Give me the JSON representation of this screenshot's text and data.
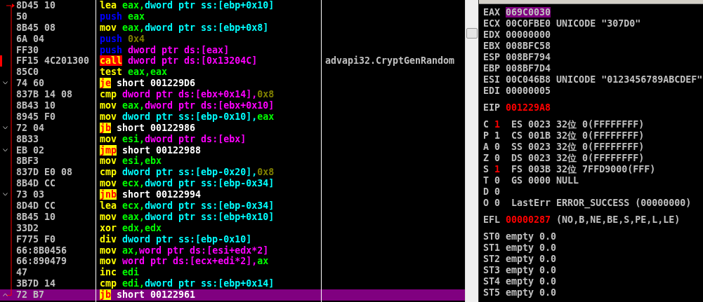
{
  "disassembly": {
    "rows": [
      {
        "hex": "8D45 10",
        "tokens": [
          {
            "text": "lea",
            "kind": "mnemonic"
          },
          {
            "text": " eax,",
            "kind": "register"
          },
          {
            "text": "dword ptr ss:[ebp+0x10]",
            "kind": "stack_mem"
          }
        ],
        "selected": false,
        "breakpoint": false
      },
      {
        "hex": "50",
        "tokens": [
          {
            "text": "push",
            "kind": "push"
          },
          {
            "text": " eax",
            "kind": "register"
          }
        ],
        "selected": false,
        "breakpoint": false
      },
      {
        "hex": "8B45 08",
        "tokens": [
          {
            "text": "mov",
            "kind": "mnemonic"
          },
          {
            "text": " eax,",
            "kind": "register"
          },
          {
            "text": "dword ptr ss:[ebp+0x8]",
            "kind": "stack_mem"
          }
        ],
        "selected": false,
        "breakpoint": false
      },
      {
        "hex": "6A 04",
        "tokens": [
          {
            "text": "push",
            "kind": "push"
          },
          {
            "text": " 0x4",
            "kind": "immediate"
          }
        ],
        "selected": false,
        "breakpoint": false
      },
      {
        "hex": "FF30",
        "tokens": [
          {
            "text": "push",
            "kind": "push"
          },
          {
            "text": " dword ptr ds:[eax]",
            "kind": "data_mem"
          }
        ],
        "selected": false,
        "breakpoint": false
      },
      {
        "hex": "FF15 4C201300",
        "tokens": [
          {
            "text": "call",
            "kind": "call"
          },
          {
            "text": " dword ptr ds:[0x13204C]",
            "kind": "data_mem"
          }
        ],
        "comment": "advapi32.CryptGenRandom",
        "selected": false,
        "breakpoint": true
      },
      {
        "hex": "85C0",
        "tokens": [
          {
            "text": "test",
            "kind": "mnemonic"
          },
          {
            "text": " eax,eax",
            "kind": "register"
          }
        ],
        "selected": false,
        "breakpoint": false
      },
      {
        "hex": "74 60",
        "jump": true,
        "backward": false,
        "tokens": [
          {
            "text": "je",
            "kind": "jump"
          },
          {
            "text": " short 001229D6",
            "kind": "target"
          }
        ],
        "selected": false,
        "breakpoint": false
      },
      {
        "hex": "837B 14 08",
        "tokens": [
          {
            "text": "cmp",
            "kind": "mnemonic"
          },
          {
            "text": " dword ptr ds:[ebx+0x14],",
            "kind": "data_mem"
          },
          {
            "text": "0x8",
            "kind": "immediate"
          }
        ],
        "selected": false,
        "breakpoint": false
      },
      {
        "hex": "8B43 10",
        "tokens": [
          {
            "text": "mov",
            "kind": "mnemonic"
          },
          {
            "text": " eax,",
            "kind": "register"
          },
          {
            "text": "dword ptr ds:[ebx+0x10]",
            "kind": "data_mem"
          }
        ],
        "selected": false,
        "breakpoint": false
      },
      {
        "hex": "8945 F0",
        "tokens": [
          {
            "text": "mov",
            "kind": "mnemonic"
          },
          {
            "text": " dword ptr ss:[ebp-0x10],",
            "kind": "stack_mem"
          },
          {
            "text": "eax",
            "kind": "register"
          }
        ],
        "selected": false,
        "breakpoint": false
      },
      {
        "hex": "72 04",
        "jump": true,
        "backward": false,
        "tokens": [
          {
            "text": "jb",
            "kind": "jump"
          },
          {
            "text": " short 00122986",
            "kind": "target"
          }
        ],
        "selected": false,
        "breakpoint": false
      },
      {
        "hex": "8B33",
        "tokens": [
          {
            "text": "mov",
            "kind": "mnemonic"
          },
          {
            "text": " esi,",
            "kind": "register"
          },
          {
            "text": "dword ptr ds:[ebx]",
            "kind": "data_mem"
          }
        ],
        "selected": false,
        "breakpoint": false
      },
      {
        "hex": "EB 02",
        "jump": true,
        "backward": false,
        "tokens": [
          {
            "text": "jmp",
            "kind": "jump"
          },
          {
            "text": " short 00122988",
            "kind": "target"
          }
        ],
        "selected": false,
        "breakpoint": false
      },
      {
        "hex": "8BF3",
        "tokens": [
          {
            "text": "mov",
            "kind": "mnemonic"
          },
          {
            "text": " esi,ebx",
            "kind": "register"
          }
        ],
        "selected": false,
        "breakpoint": false
      },
      {
        "hex": "837D E0 08",
        "tokens": [
          {
            "text": "cmp",
            "kind": "mnemonic"
          },
          {
            "text": " dword ptr ss:[ebp-0x20],",
            "kind": "stack_mem"
          },
          {
            "text": "0x8",
            "kind": "immediate"
          }
        ],
        "selected": false,
        "breakpoint": false
      },
      {
        "hex": "8B4D CC",
        "tokens": [
          {
            "text": "mov",
            "kind": "mnemonic"
          },
          {
            "text": " ecx,",
            "kind": "register"
          },
          {
            "text": "dword ptr ss:[ebp-0x34]",
            "kind": "stack_mem"
          }
        ],
        "selected": false,
        "breakpoint": false
      },
      {
        "hex": "73 03",
        "jump": true,
        "backward": false,
        "tokens": [
          {
            "text": "jnb",
            "kind": "jump"
          },
          {
            "text": " short 00122994",
            "kind": "target"
          }
        ],
        "selected": false,
        "breakpoint": false
      },
      {
        "hex": "8D4D CC",
        "tokens": [
          {
            "text": "lea",
            "kind": "mnemonic"
          },
          {
            "text": " ecx,",
            "kind": "register"
          },
          {
            "text": "dword ptr ss:[ebp-0x34]",
            "kind": "stack_mem"
          }
        ],
        "selected": false,
        "breakpoint": false
      },
      {
        "hex": "8B45 10",
        "tokens": [
          {
            "text": "mov",
            "kind": "mnemonic"
          },
          {
            "text": " eax,",
            "kind": "register"
          },
          {
            "text": "dword ptr ss:[ebp+0x10]",
            "kind": "stack_mem"
          }
        ],
        "selected": false,
        "breakpoint": false
      },
      {
        "hex": "33D2",
        "tokens": [
          {
            "text": "xor",
            "kind": "mnemonic"
          },
          {
            "text": " edx,edx",
            "kind": "register"
          }
        ],
        "selected": false,
        "breakpoint": false
      },
      {
        "hex": "F775 F0",
        "tokens": [
          {
            "text": "div",
            "kind": "mnemonic"
          },
          {
            "text": " dword ptr ss:[ebp-0x10]",
            "kind": "stack_mem"
          }
        ],
        "selected": false,
        "breakpoint": false
      },
      {
        "hex": "66:8B0456",
        "tokens": [
          {
            "text": "mov",
            "kind": "mnemonic"
          },
          {
            "text": " ax,",
            "kind": "register"
          },
          {
            "text": "word ptr ds:[esi+edx*2]",
            "kind": "data_mem"
          }
        ],
        "selected": false,
        "breakpoint": false
      },
      {
        "hex": "66:890479",
        "tokens": [
          {
            "text": "mov",
            "kind": "mnemonic"
          },
          {
            "text": " word ptr ds:[ecx+edi*2],",
            "kind": "data_mem"
          },
          {
            "text": "ax",
            "kind": "register"
          }
        ],
        "selected": false,
        "breakpoint": false
      },
      {
        "hex": "47",
        "tokens": [
          {
            "text": "inc",
            "kind": "mnemonic"
          },
          {
            "text": " edi",
            "kind": "register"
          }
        ],
        "selected": false,
        "breakpoint": false
      },
      {
        "hex": "3B7D 14",
        "tokens": [
          {
            "text": "cmp",
            "kind": "mnemonic"
          },
          {
            "text": " edi,",
            "kind": "register"
          },
          {
            "text": "dword ptr ss:[ebp+0x14]",
            "kind": "stack_mem"
          }
        ],
        "selected": false,
        "breakpoint": false
      },
      {
        "hex": "72 B7",
        "jump": true,
        "backward": true,
        "tokens": [
          {
            "text": "jb",
            "kind": "jump"
          },
          {
            "text": " short 00122961",
            "kind": "target"
          }
        ],
        "selected": true,
        "breakpoint": false
      }
    ]
  },
  "registers": {
    "general": [
      {
        "name": "EAX",
        "value": "069C0030",
        "selected": true,
        "changed": false
      },
      {
        "name": "ECX",
        "value": "00C0FBE0",
        "comment": "UNICODE \"307D0\"",
        "selected": false,
        "changed": false
      },
      {
        "name": "EDX",
        "value": "00000000",
        "selected": false,
        "changed": false
      },
      {
        "name": "EBX",
        "value": "008BFC58",
        "selected": false,
        "changed": false
      },
      {
        "name": "ESP",
        "value": "008BF794",
        "selected": false,
        "changed": false
      },
      {
        "name": "EBP",
        "value": "008BF7D4",
        "selected": false,
        "changed": false
      },
      {
        "name": "ESI",
        "value": "00C046B8",
        "comment": "UNICODE \"0123456789ABCDEF\"",
        "selected": false,
        "changed": false
      },
      {
        "name": "EDI",
        "value": "00000005",
        "selected": false,
        "changed": false
      }
    ],
    "eip": {
      "name": "EIP",
      "value": "001229A8",
      "changed": true
    },
    "flags": [
      {
        "flag": "C",
        "bit": "1",
        "changed": true,
        "segment": "ES 0023 32位 0(FFFFFFFF)"
      },
      {
        "flag": "P",
        "bit": "1",
        "changed": false,
        "segment": "CS 001B 32位 0(FFFFFFFF)"
      },
      {
        "flag": "A",
        "bit": "0",
        "changed": false,
        "segment": "SS 0023 32位 0(FFFFFFFF)"
      },
      {
        "flag": "Z",
        "bit": "0",
        "changed": false,
        "segment": "DS 0023 32位 0(FFFFFFFF)"
      },
      {
        "flag": "S",
        "bit": "1",
        "changed": true,
        "segment": "FS 003B 32位 7FFD9000(FFF)"
      },
      {
        "flag": "T",
        "bit": "0",
        "changed": false,
        "segment": "GS 0000 NULL"
      },
      {
        "flag": "D",
        "bit": "0",
        "changed": false
      },
      {
        "flag": "O",
        "bit": "0",
        "changed": false,
        "segment": "LastErr ERROR_SUCCESS (00000000)"
      }
    ],
    "efl": {
      "name": "EFL",
      "value": "00000287",
      "comment": "(NO,B,NE,BE,S,PE,L,LE)",
      "changed": true
    },
    "fpu": [
      {
        "name": "ST0",
        "value": "empty 0.0"
      },
      {
        "name": "ST1",
        "value": "empty 0.0"
      },
      {
        "name": "ST2",
        "value": "empty 0.0"
      },
      {
        "name": "ST3",
        "value": "empty 0.0"
      },
      {
        "name": "ST4",
        "value": "empty 0.0"
      },
      {
        "name": "ST5",
        "value": "empty 0.0"
      }
    ]
  }
}
